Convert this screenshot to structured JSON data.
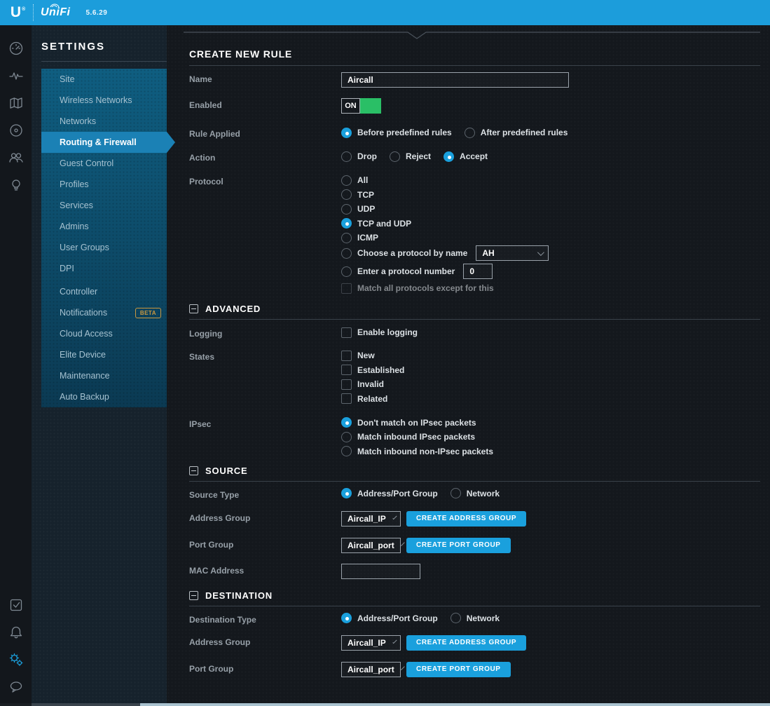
{
  "topbar": {
    "logo_letter": "U",
    "brand": "UniFi",
    "version": "5.6.29",
    "color": "#1c9ddb"
  },
  "rail": {
    "top_icons": [
      "dashboard-icon",
      "statistics-icon",
      "map-icon",
      "devices-icon",
      "clients-icon",
      "insights-icon"
    ],
    "bottom_icons": [
      "events-icon",
      "alerts-icon",
      "settings-icon",
      "chat-icon"
    ],
    "active_icon": "settings-icon",
    "accent": "#1ba0dd"
  },
  "sidebar": {
    "title": "SETTINGS",
    "selected": "Routing & Firewall",
    "items": [
      {
        "label": "Site"
      },
      {
        "label": "Wireless Networks"
      },
      {
        "label": "Networks"
      },
      {
        "label": "Routing & Firewall"
      },
      {
        "label": "Guest Control"
      },
      {
        "label": "Profiles"
      },
      {
        "label": "Services"
      },
      {
        "label": "Admins"
      },
      {
        "label": "User Groups"
      },
      {
        "label": "DPI"
      },
      {
        "label": "Controller"
      },
      {
        "label": "Notifications",
        "badge": "BETA"
      },
      {
        "label": "Cloud Access"
      },
      {
        "label": "Elite Device"
      },
      {
        "label": "Maintenance"
      },
      {
        "label": "Auto Backup"
      }
    ]
  },
  "rule": {
    "header": "CREATE NEW RULE",
    "name": {
      "label": "Name",
      "value": "Aircall"
    },
    "enabled": {
      "label": "Enabled",
      "state": "ON",
      "on_color": "#2abf66"
    },
    "rule_applied": {
      "label": "Rule Applied",
      "options": [
        "Before predefined rules",
        "After predefined rules"
      ],
      "selected": "Before predefined rules"
    },
    "action": {
      "label": "Action",
      "options": [
        "Drop",
        "Reject",
        "Accept"
      ],
      "selected": "Accept"
    },
    "protocol": {
      "label": "Protocol",
      "options": [
        "All",
        "TCP",
        "UDP",
        "TCP and UDP",
        "ICMP"
      ],
      "selected": "TCP and UDP",
      "by_name_label": "Choose a protocol by name",
      "by_name_value": "AH",
      "by_number_label": "Enter a protocol number",
      "by_number_value": "0",
      "match_all_label": "Match all protocols except for this",
      "match_all_checked": false
    },
    "advanced": {
      "header": "ADVANCED",
      "logging": {
        "label": "Logging",
        "option": "Enable logging",
        "checked": false
      },
      "states": {
        "label": "States",
        "options": [
          "New",
          "Established",
          "Invalid",
          "Related"
        ],
        "checked": []
      },
      "ipsec": {
        "label": "IPsec",
        "options": [
          "Don't match on IPsec packets",
          "Match inbound IPsec packets",
          "Match inbound non-IPsec packets"
        ],
        "selected": "Don't match on IPsec packets"
      }
    },
    "source": {
      "header": "SOURCE",
      "type": {
        "label": "Source Type",
        "options": [
          "Address/Port Group",
          "Network"
        ],
        "selected": "Address/Port Group"
      },
      "address_group": {
        "label": "Address Group",
        "value": "Aircall_IP",
        "button": "CREATE ADDRESS GROUP"
      },
      "port_group": {
        "label": "Port Group",
        "value": "Aircall_port",
        "button": "CREATE PORT GROUP"
      },
      "mac": {
        "label": "MAC Address",
        "value": ""
      }
    },
    "destination": {
      "header": "DESTINATION",
      "type": {
        "label": "Destination Type",
        "options": [
          "Address/Port Group",
          "Network"
        ],
        "selected": "Address/Port Group"
      },
      "address_group": {
        "label": "Address Group",
        "value": "Aircall_IP",
        "button": "CREATE ADDRESS GROUP"
      },
      "port_group": {
        "label": "Port Group",
        "value": "Aircall_port",
        "button": "CREATE PORT GROUP"
      }
    }
  }
}
